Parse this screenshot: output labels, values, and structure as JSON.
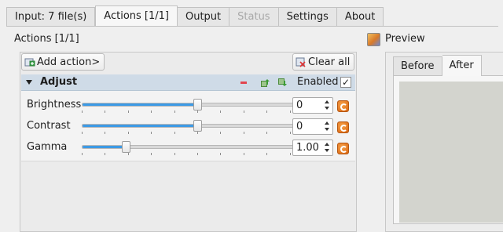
{
  "tabs": [
    {
      "label": "Input: 7 file(s)",
      "state": "normal"
    },
    {
      "label": "Actions [1/1]",
      "state": "active"
    },
    {
      "label": "Output",
      "state": "normal"
    },
    {
      "label": "Status",
      "state": "disabled"
    },
    {
      "label": "Settings",
      "state": "normal"
    },
    {
      "label": "About",
      "state": "normal"
    }
  ],
  "actions_panel": {
    "title": "Actions [1/1]",
    "add_label": "Add action>",
    "clear_label": "Clear all"
  },
  "action": {
    "name": "Adjust",
    "enabled_label": "Enabled",
    "enabled_check": "✓",
    "enabled": true,
    "params": [
      {
        "label": "Brightness",
        "value": "0",
        "slider_fraction": 0.5
      },
      {
        "label": "Contrast",
        "value": "0",
        "slider_fraction": 0.5
      },
      {
        "label": "Gamma",
        "value": "1.00",
        "slider_fraction": 0.19
      }
    ]
  },
  "preview": {
    "title": "Preview",
    "tabs": [
      {
        "label": "Before",
        "state": "normal"
      },
      {
        "label": "After",
        "state": "active"
      }
    ]
  },
  "colors": {
    "accent": "#3d9ae5",
    "header_bg": "#cfdbe7",
    "reset_orange": "#e8781c",
    "remove_red": "#e2454f"
  }
}
